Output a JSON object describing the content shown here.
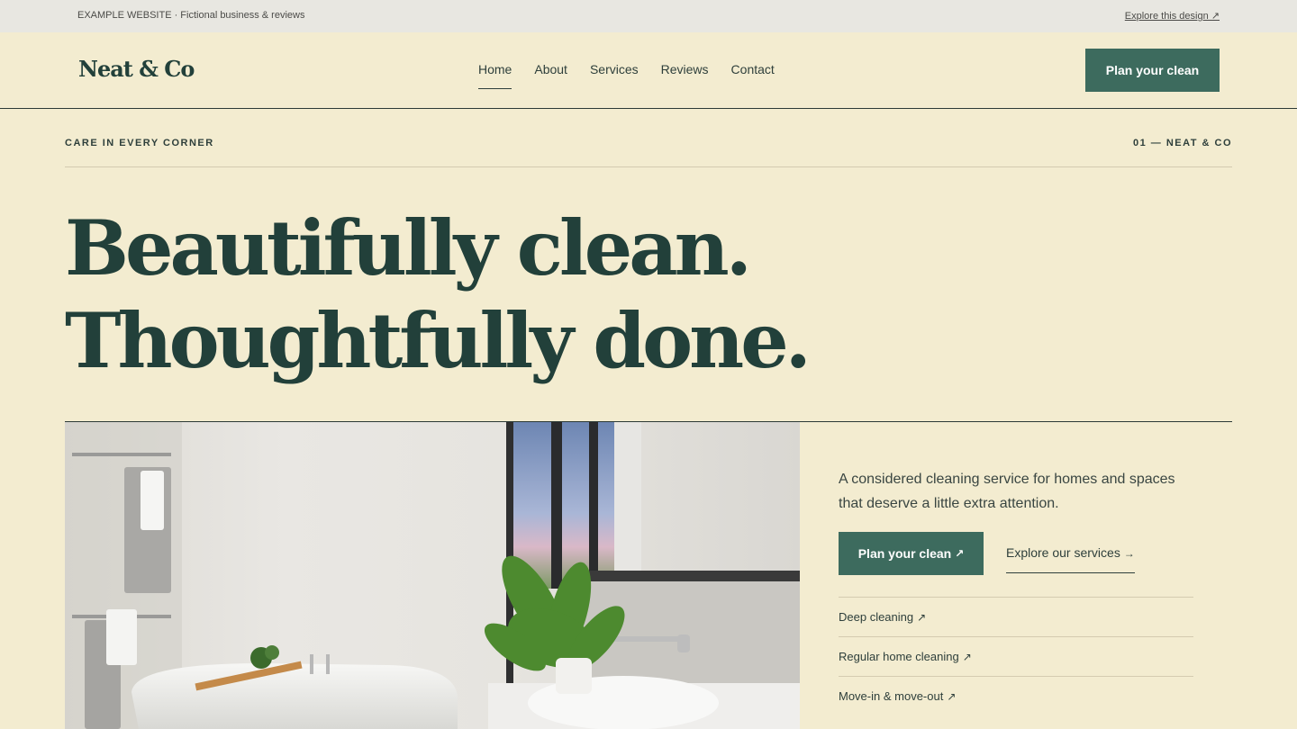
{
  "topbar": {
    "left_text": "EXAMPLE WEBSITE · Fictional business & reviews",
    "right_link": "Explore this design ↗"
  },
  "header": {
    "logo": "Neat & Co",
    "nav": [
      "Home",
      "About",
      "Services",
      "Reviews",
      "Contact"
    ],
    "active_nav": "Home",
    "cta": "Plan your clean"
  },
  "hero": {
    "eyebrow_left": "CARE IN EVERY CORNER",
    "eyebrow_right": "01 — NEAT & CO",
    "headline_line1": "Beautifully clean.",
    "headline_line2": "Thoughtfully done.",
    "intro": "A considered cleaning service for homes and spaces that deserve a little extra attention.",
    "primary_cta": "Plan your clean",
    "primary_cta_icon": "↗",
    "secondary_cta": "Explore our services",
    "secondary_cta_icon": "→",
    "services": [
      {
        "label": "Deep cleaning",
        "icon": "↗"
      },
      {
        "label": "Regular home cleaning",
        "icon": "↗"
      },
      {
        "label": "Move-in & move-out",
        "icon": "↗"
      }
    ]
  },
  "colors": {
    "background": "#f3ecd0",
    "primary": "#3d6b5e",
    "text_dark": "#22403a",
    "topbar": "#e8e7e1"
  }
}
